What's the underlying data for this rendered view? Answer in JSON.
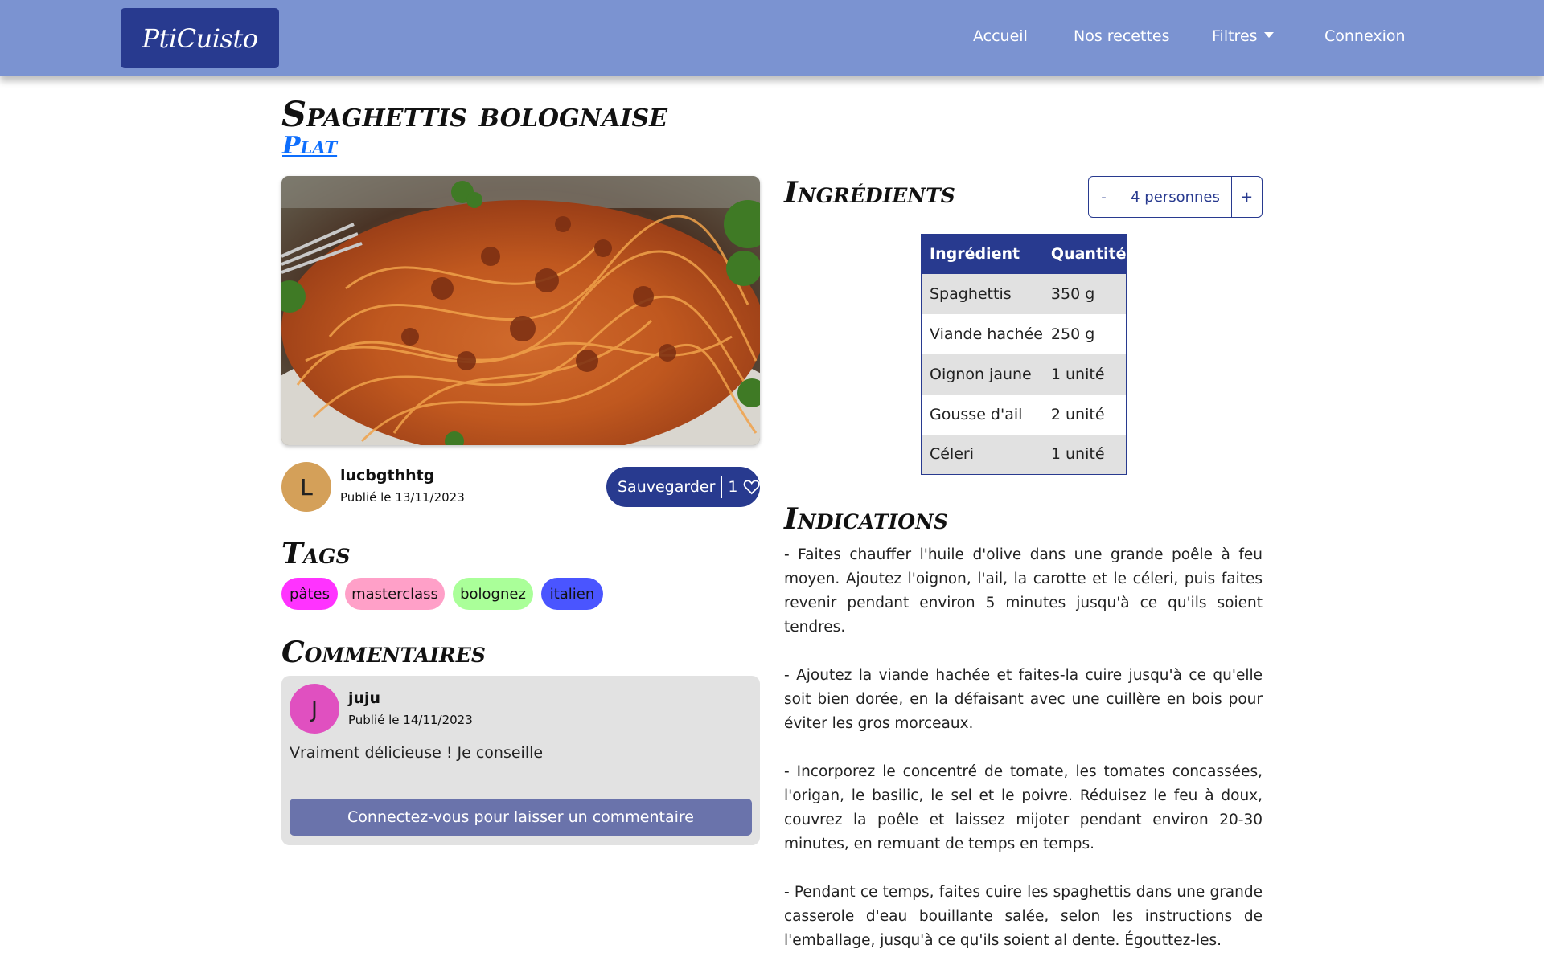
{
  "nav": {
    "brand": "PtiCuisto",
    "links": [
      "Accueil",
      "Nos recettes",
      "Filtres",
      "Connexion"
    ]
  },
  "recipe": {
    "title": "Spaghettis bolognaise",
    "category": "Plat",
    "author": {
      "initial": "L",
      "name": "lucbgthhtg",
      "date": "Publié le 13/11/2023"
    },
    "save_label": "Sauvegarder",
    "likes": "1"
  },
  "tags": {
    "heading": "Tags",
    "items": [
      {
        "label": "pâtes",
        "color": "#ff33ff"
      },
      {
        "label": "masterclass",
        "color": "#ffa0c8"
      },
      {
        "label": "bolognez",
        "color": "#aaff99"
      },
      {
        "label": "italien",
        "color": "#4a55ff"
      }
    ]
  },
  "comments": {
    "heading": "Commentaires",
    "items": [
      {
        "initial": "J",
        "name": "juju",
        "date": "Publié le 14/11/2023",
        "text": "Vraiment délicieuse ! Je conseille",
        "avatar_color": "#e050c0"
      }
    ],
    "login_prompt": "Connectez-vous pour laisser un commentaire"
  },
  "ingredients": {
    "heading": "Ingrédients",
    "servings": "4 personnes",
    "minus": "-",
    "plus": "+",
    "columns": [
      "Ingrédient",
      "Quantité"
    ],
    "rows": [
      [
        "Spaghettis",
        "350 g"
      ],
      [
        "Viande hachée",
        "250 g"
      ],
      [
        "Oignon jaune",
        "1 unité"
      ],
      [
        "Gousse d'ail",
        "2 unité"
      ],
      [
        "Céleri",
        "1 unité"
      ]
    ]
  },
  "indications": {
    "heading": "Indications",
    "steps": [
      "- Faites chauffer l'huile d'olive dans une grande poêle à feu moyen. Ajoutez l'oignon, l'ail, la carotte et le céleri, puis faites revenir pendant environ 5 minutes jusqu'à ce qu'ils soient tendres.",
      "- Ajoutez la viande hachée et faites-la cuire jusqu'à ce qu'elle soit bien dorée, en la défaisant avec une cuillère en bois pour éviter les gros morceaux.",
      "- Incorporez le concentré de tomate, les tomates concassées, l'origan, le basilic, le sel et le poivre. Réduisez le feu à doux, couvrez la poêle et laissez mijoter pendant environ 20-30 minutes, en remuant de temps en temps.",
      "- Pendant ce temps, faites cuire les spaghettis dans une grande casserole d'eau bouillante salée, selon les instructions de l'emballage, jusqu'à ce qu'ils soient al dente. Égouttez-les."
    ]
  },
  "colors": {
    "navbar": "#7b93d1",
    "primary": "#283a8f",
    "link": "#0d6efd",
    "author_avatar": "#d4a059"
  }
}
